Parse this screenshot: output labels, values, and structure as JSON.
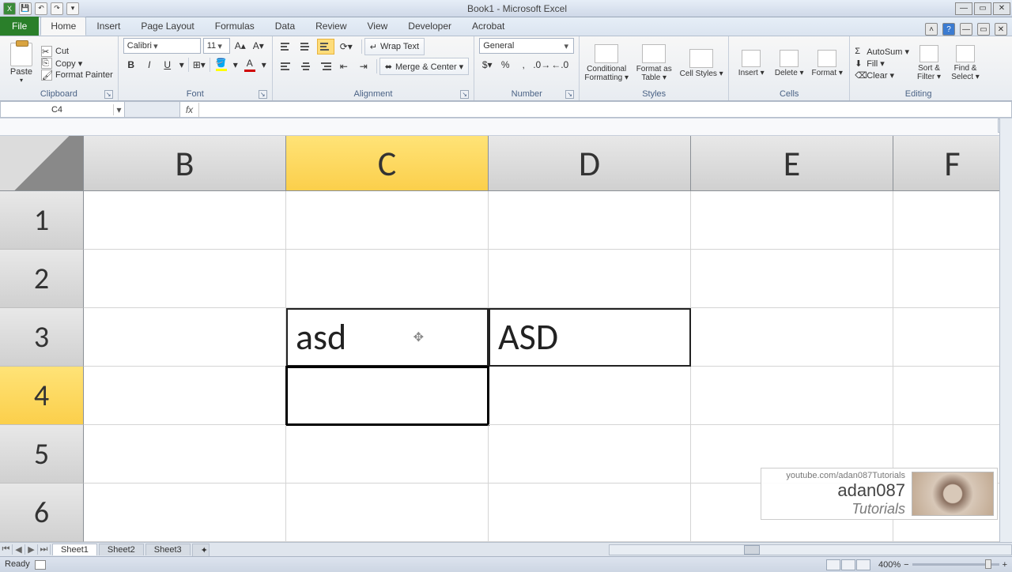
{
  "title": "Book1 - Microsoft Excel",
  "tabs": {
    "file": "File",
    "home": "Home",
    "insert": "Insert",
    "pagelayout": "Page Layout",
    "formulas": "Formulas",
    "data": "Data",
    "review": "Review",
    "view": "View",
    "developer": "Developer",
    "acrobat": "Acrobat"
  },
  "clipboard": {
    "paste": "Paste",
    "cut": "Cut",
    "copy": "Copy ▾",
    "format_painter": "Format Painter",
    "label": "Clipboard"
  },
  "font": {
    "name": "Calibri",
    "size": "11",
    "label": "Font"
  },
  "alignment": {
    "wrap": "Wrap Text",
    "merge": "Merge & Center ▾",
    "label": "Alignment"
  },
  "number": {
    "format": "General",
    "label": "Number"
  },
  "styles": {
    "cond": "Conditional Formatting ▾",
    "table": "Format as Table ▾",
    "cell": "Cell Styles ▾",
    "label": "Styles"
  },
  "cells": {
    "insert": "Insert ▾",
    "delete": "Delete ▾",
    "format": "Format ▾",
    "label": "Cells"
  },
  "editing": {
    "sum": "AutoSum ▾",
    "fill": "Fill ▾",
    "clear": "Clear ▾",
    "sort": "Sort & Filter ▾",
    "find": "Find & Select ▾",
    "label": "Editing"
  },
  "namebox": "C4",
  "formula": "",
  "columns": {
    "B": "B",
    "C": "C",
    "D": "D",
    "E": "E",
    "F": "F"
  },
  "rows": {
    "1": "1",
    "2": "2",
    "3": "3",
    "4": "4",
    "5": "5",
    "6": "6"
  },
  "cellsdata": {
    "C3": "asd",
    "D3": "ASD"
  },
  "sheets": {
    "s1": "Sheet1",
    "s2": "Sheet2",
    "s3": "Sheet3"
  },
  "status": "Ready",
  "zoom": {
    "minus": "−",
    "plus": "+",
    "pct": "400%"
  },
  "watermark": {
    "url": "youtube.com/adan087Tutorials",
    "name": "adan087",
    "tut": "Tutorials"
  }
}
